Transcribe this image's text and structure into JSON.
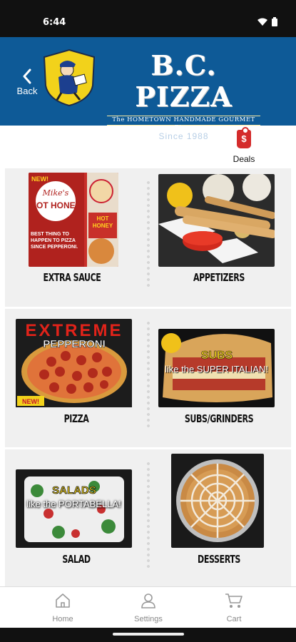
{
  "status": {
    "time": "6:44"
  },
  "header": {
    "back_label": "Back",
    "brand_name": "B.C. PIZZA",
    "tagline": "The HOMETOWN HANDMADE GOURMET Pizza",
    "since": "Since 1988",
    "accent_color": "#0e5a97",
    "badge_color": "#f2d21b"
  },
  "deals": {
    "label": "Deals",
    "icon": "price-tag-icon"
  },
  "menu": {
    "items": [
      {
        "caption": "EXTRA SAUCE",
        "image": "hot-honey-promo-image",
        "promo_new": "NEW!",
        "promo_brand": "Mike's",
        "promo_title": "HOT HONEY",
        "promo_text": "BEST THING TO HAPPEN TO PIZZA SINCE PEPPERONI.",
        "promo_side": "HOT HONEY"
      },
      {
        "caption": "APPETIZERS",
        "image": "breadsticks-image"
      },
      {
        "caption": "PIZZA",
        "image": "extreme-pepperoni-image",
        "promo_title": "EXTREME",
        "promo_sub": "PEPPERONI",
        "promo_new": "NEW!"
      },
      {
        "caption": "SUBS/GRINDERS",
        "image": "subs-image",
        "promo_title": "SUBS",
        "promo_text": "like the SUPER ITALIAN!"
      },
      {
        "caption": "SALAD",
        "image": "salads-image",
        "promo_title": "SALADS",
        "promo_text": "like the PORTABELLA!"
      },
      {
        "caption": "DESSERTS",
        "image": "dessert-pizza-image"
      }
    ]
  },
  "tabs": [
    {
      "label": "Home",
      "icon": "home-icon"
    },
    {
      "label": "Settings",
      "icon": "user-icon"
    },
    {
      "label": "Cart",
      "icon": "cart-icon"
    }
  ]
}
